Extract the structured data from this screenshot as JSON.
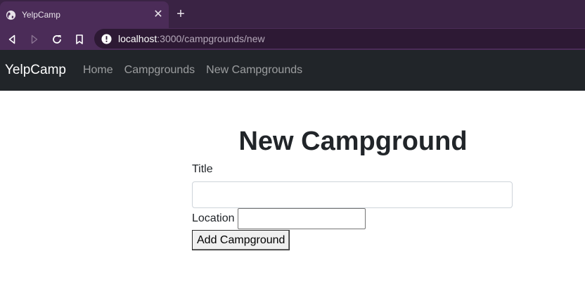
{
  "browser": {
    "tab": {
      "title": "YelpCamp",
      "favicon": "globe-icon",
      "close_glyph": "✕"
    },
    "new_tab_glyph": "+",
    "toolbar": {
      "back": "back-icon",
      "forward": "forward-icon",
      "reload": "reload-icon",
      "bookmark": "bookmark-icon"
    },
    "address": {
      "host": "localhost",
      "path": ":3000/campgrounds/new"
    },
    "colors": {
      "tabstrip": "#3a2344",
      "toolbar": "#4b2c58",
      "omnibox": "#2d1934"
    }
  },
  "navbar": {
    "brand": "YelpCamp",
    "links": [
      "Home",
      "Campgrounds",
      "New Campgrounds"
    ],
    "colors": {
      "background": "#212529",
      "link": "rgba(255,255,255,0.55)"
    }
  },
  "form": {
    "heading": "New Campground",
    "title_label": "Title",
    "title_value": "",
    "location_label": "Location",
    "location_value": "",
    "submit_label": "Add Campground"
  }
}
